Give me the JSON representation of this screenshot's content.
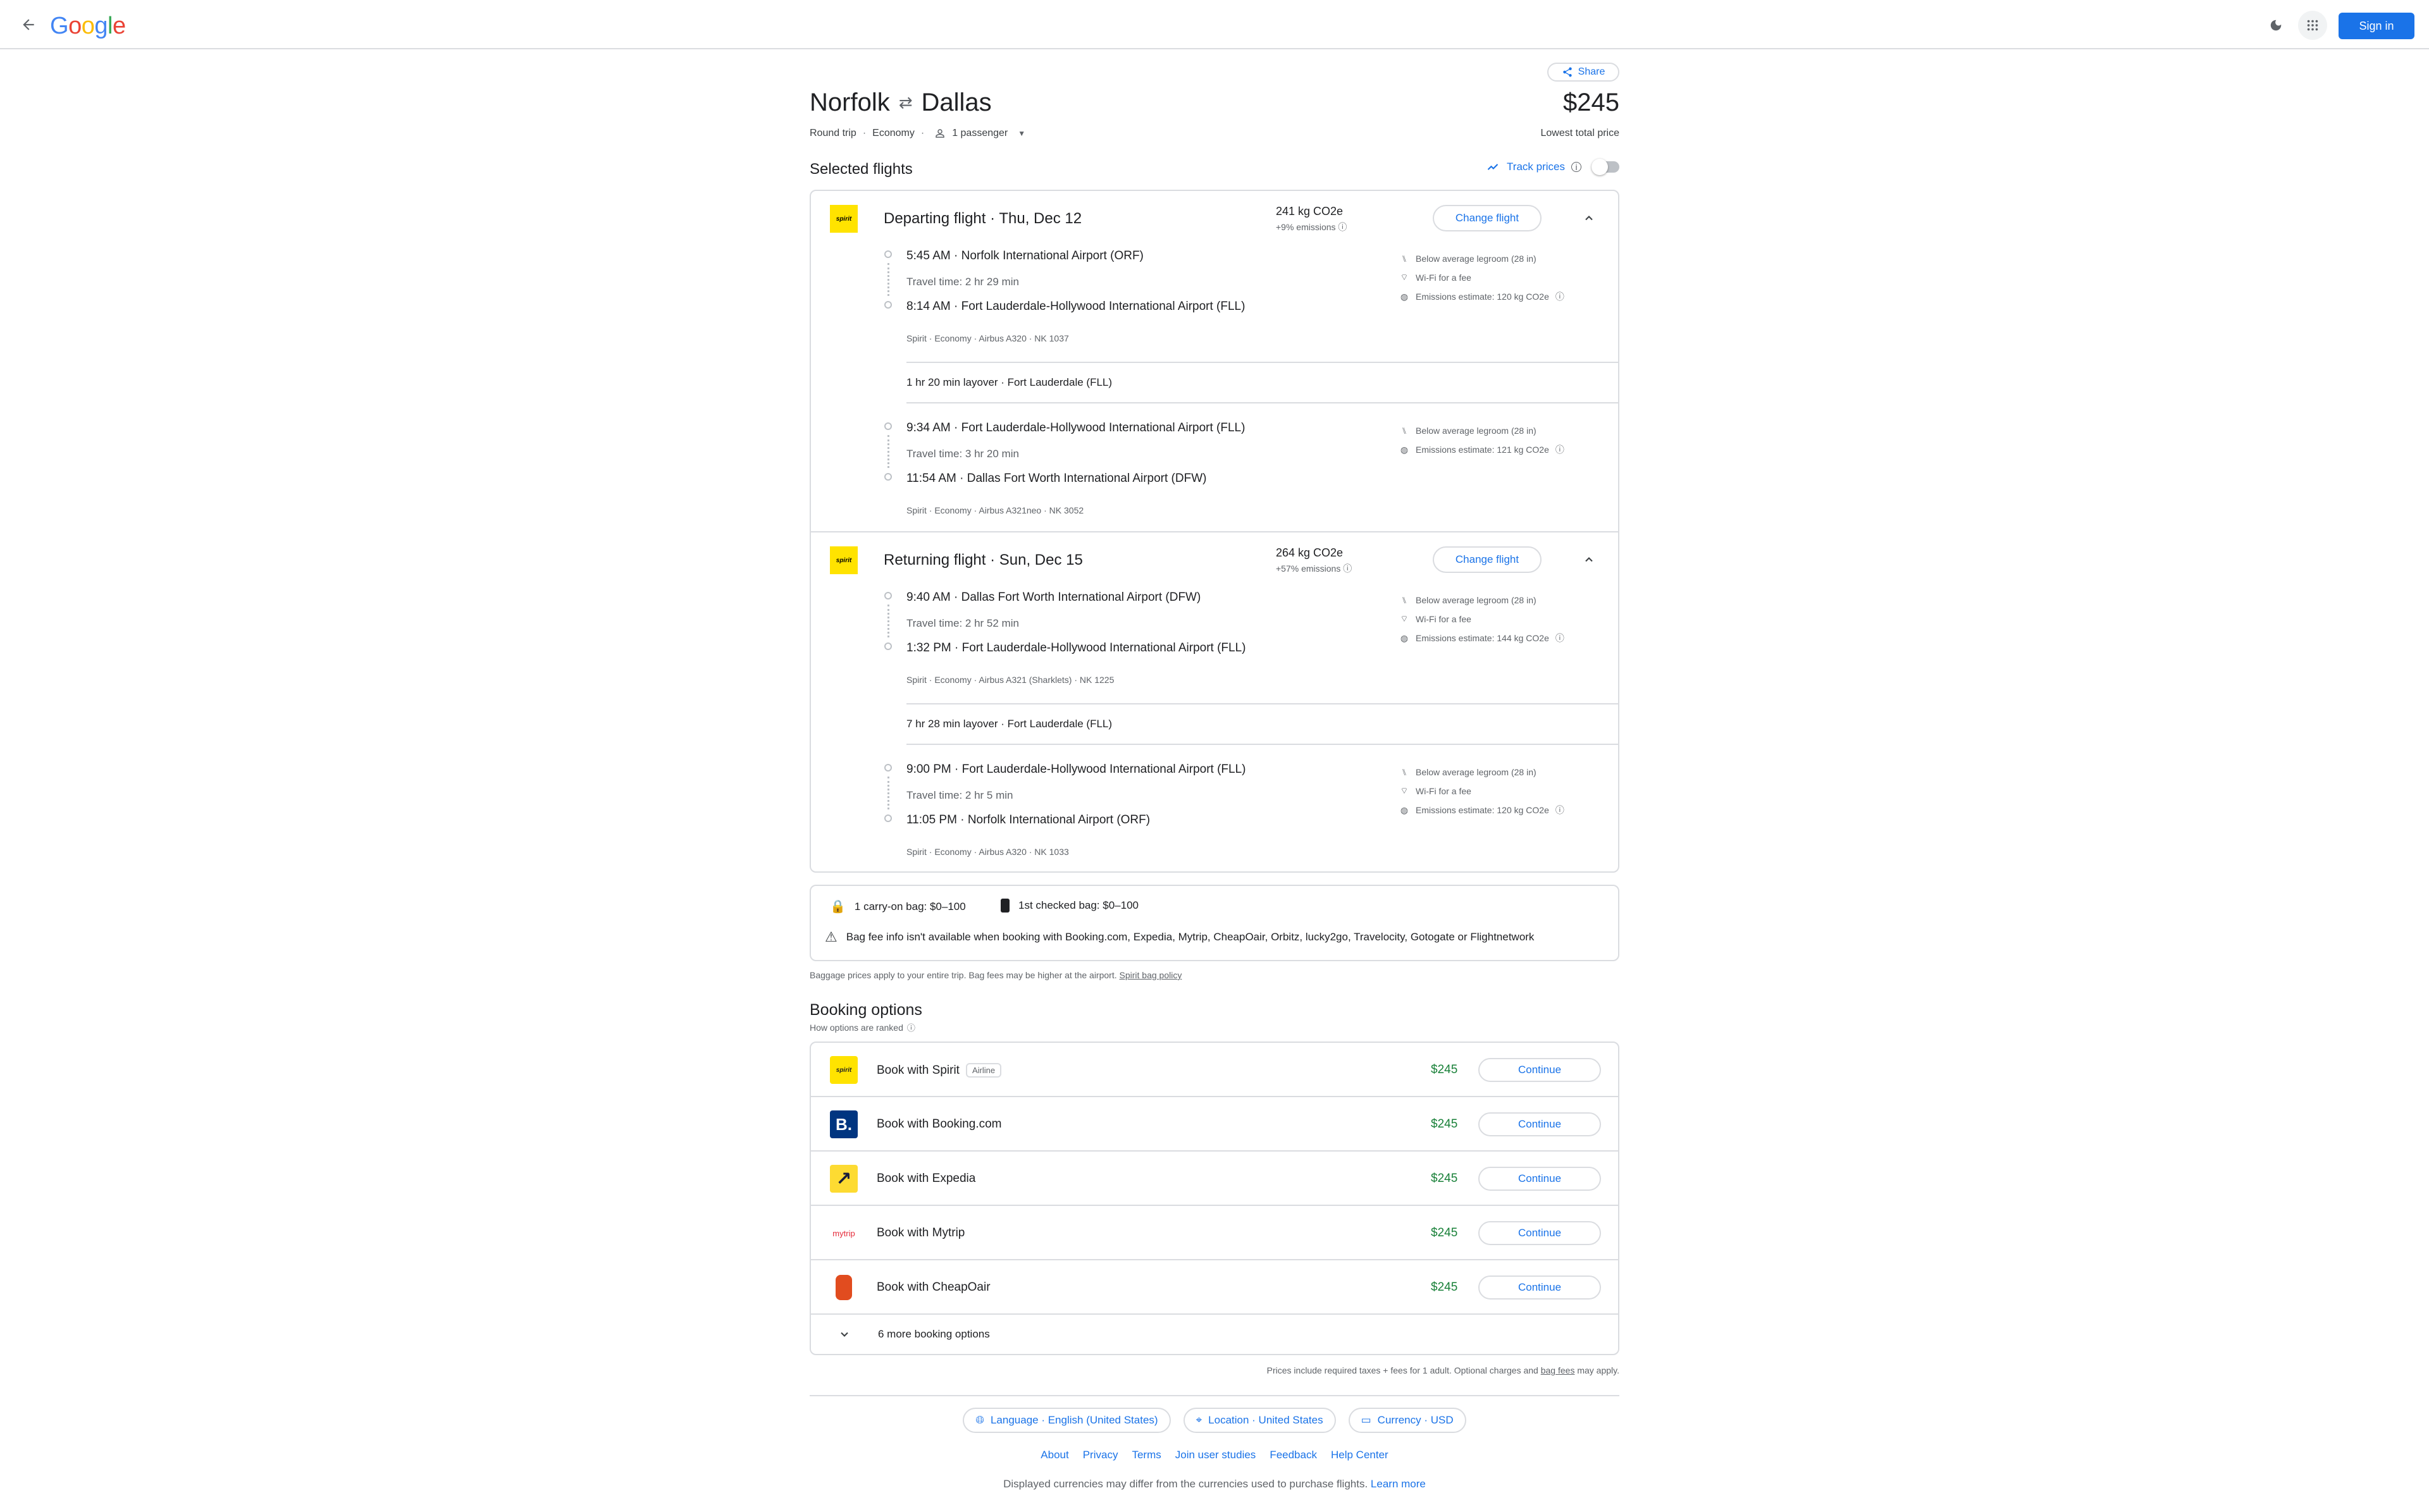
{
  "header": {
    "logo_text": "Google",
    "sign_in_label": "Sign in"
  },
  "trip": {
    "share_label": "Share",
    "origin": "Norfolk",
    "destination": "Dallas",
    "trip_type": "Round trip",
    "cabin": "Economy",
    "passengers": "1 passenger",
    "price": "$245",
    "price_caption": "Lowest total price",
    "selected_title": "Selected flights",
    "track_prices_label": "Track prices"
  },
  "departing": {
    "title": "Departing flight",
    "date": "Thu, Dec 12",
    "co2": "241 kg CO2e",
    "co2_sub": "+9% emissions",
    "change_label": "Change flight",
    "segments": [
      {
        "dep": "5:45 AM",
        "dep_airport": "Norfolk International Airport (ORF)",
        "travel": "Travel time: 2 hr 29 min",
        "arr": "8:14 AM",
        "arr_airport": "Fort Lauderdale-Hollywood International Airport (FLL)",
        "info": "Spirit · Economy · Airbus A320 · NK 1037",
        "amenities": [
          "Below average legroom (28 in)",
          "Wi-Fi for a fee",
          "Emissions estimate: 120 kg CO2e"
        ]
      },
      {
        "dep": "9:34 AM",
        "dep_airport": "Fort Lauderdale-Hollywood International Airport (FLL)",
        "travel": "Travel time: 3 hr 20 min",
        "arr": "11:54 AM",
        "arr_airport": "Dallas Fort Worth International Airport (DFW)",
        "info": "Spirit · Economy · Airbus A321neo · NK 3052",
        "amenities": [
          "Below average legroom (28 in)",
          "Emissions estimate: 121 kg CO2e"
        ]
      }
    ],
    "layover": "1 hr 20 min layover · Fort Lauderdale (FLL)"
  },
  "returning": {
    "title": "Returning flight",
    "date": "Sun, Dec 15",
    "co2": "264 kg CO2e",
    "co2_sub": "+57% emissions",
    "change_label": "Change flight",
    "segments": [
      {
        "dep": "9:40 AM",
        "dep_airport": "Dallas Fort Worth International Airport (DFW)",
        "travel": "Travel time: 2 hr 52 min",
        "arr": "1:32 PM",
        "arr_airport": "Fort Lauderdale-Hollywood International Airport (FLL)",
        "info": "Spirit · Economy · Airbus A321 (Sharklets) · NK 1225",
        "amenities": [
          "Below average legroom (28 in)",
          "Wi-Fi for a fee",
          "Emissions estimate: 144 kg CO2e"
        ]
      },
      {
        "dep": "9:00 PM",
        "dep_airport": "Fort Lauderdale-Hollywood International Airport (FLL)",
        "travel": "Travel time: 2 hr 5 min",
        "arr": "11:05 PM",
        "arr_airport": "Norfolk International Airport (ORF)",
        "info": "Spirit · Economy · Airbus A320 · NK 1033",
        "amenities": [
          "Below average legroom (28 in)",
          "Wi-Fi for a fee",
          "Emissions estimate: 120 kg CO2e"
        ]
      }
    ],
    "layover": "7 hr 28 min layover · Fort Lauderdale (FLL)"
  },
  "airline_logo_text": "spirit",
  "bags": {
    "carry_on": "1 carry-on bag: $0–100",
    "checked": "1st checked bag: $0–100",
    "warning": "Bag fee info isn't available when booking with Booking.com, Expedia, Mytrip, CheapOair, Orbitz, lucky2go, Travelocity, Gotogate or Flightnetwork",
    "note": "Baggage prices apply to your entire trip. Bag fees may be higher at the airport.",
    "policy_link": "Spirit bag policy"
  },
  "booking": {
    "title": "Booking options",
    "subtitle": "How options are ranked",
    "options": [
      {
        "name": "Book with Spirit",
        "badge": "Airline",
        "price": "$245",
        "cta": "Continue",
        "logo": "spirit"
      },
      {
        "name": "Book with Booking.com",
        "price": "$245",
        "cta": "Continue",
        "logo": "B."
      },
      {
        "name": "Book with Expedia",
        "price": "$245",
        "cta": "Continue",
        "logo": "↗"
      },
      {
        "name": "Book with Mytrip",
        "price": "$245",
        "cta": "Continue",
        "logo": "mytrip"
      },
      {
        "name": "Book with CheapOair",
        "price": "$245",
        "cta": "Continue",
        "logo": "cheapoair"
      }
    ],
    "more": "6 more booking options"
  },
  "footer": {
    "price_note_pre": "Prices include required taxes + fees for 1 adult. Optional charges and ",
    "price_note_link": "bag fees",
    "price_note_post": " may apply.",
    "language": "Language · English (United States)",
    "location": "Location · United States",
    "currency": "Currency · USD",
    "links": [
      "About",
      "Privacy",
      "Terms",
      "Join user studies",
      "Feedback",
      "Help Center"
    ],
    "disclaimer": "Displayed currencies may differ from the currencies used to purchase flights.",
    "learn_more": "Learn more"
  }
}
